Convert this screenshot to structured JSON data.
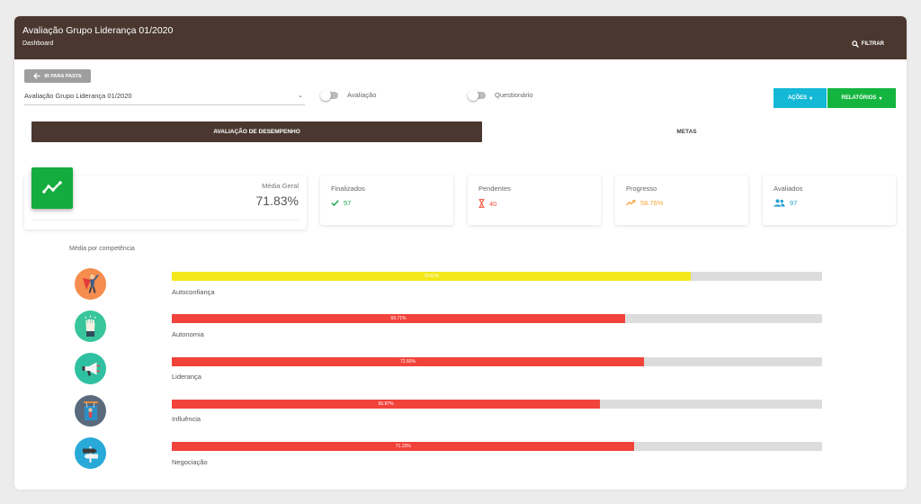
{
  "header": {
    "title": "Avaliação Grupo Liderança 01/2020",
    "subtitle": "Dashboard",
    "filter_label": "FILTRAR"
  },
  "toolbar": {
    "back_label": "IR PARA PASTA",
    "select_value": "Avaliação Grupo Liderança 01/2020",
    "toggle_avaliacao": "Avaliação",
    "toggle_questionario": "Questionário",
    "acoes_label": "AÇÕES",
    "relatorios_label": "RELATÓRIOS"
  },
  "tabs": {
    "active": "AVALIAÇÃO DE DESEMPENHO",
    "other": "METAS"
  },
  "summary": {
    "label": "Média Geral",
    "value": "71.83%"
  },
  "stats": [
    {
      "label": "Finalizados",
      "value": "57",
      "icon": "check-icon",
      "color": "#1ba64a"
    },
    {
      "label": "Pendentes",
      "value": "40",
      "icon": "hourglass-icon",
      "color": "#f0523b"
    },
    {
      "label": "Progresso",
      "value": "58.76%",
      "icon": "trending-up-icon",
      "color": "#f7a23a"
    },
    {
      "label": "Avaliados",
      "value": "97",
      "icon": "people-icon",
      "color": "#25a0d0"
    }
  ],
  "competencies": {
    "title": "Média por competência",
    "items": [
      {
        "name": "Autoconfiança",
        "percent": 79.81,
        "label": "79.81%",
        "color": "#f2e81a",
        "icon": "hero-icon"
      },
      {
        "name": "Autonomia",
        "percent": 69.71,
        "label": "69.71%",
        "color": "#f2433a",
        "icon": "raised-fist-icon"
      },
      {
        "name": "Liderança",
        "percent": 72.6,
        "label": "72.60%",
        "color": "#f2433a",
        "icon": "megaphone-icon"
      },
      {
        "name": "Influência",
        "percent": 65.87,
        "label": "65.87%",
        "color": "#f2433a",
        "icon": "puppet-icon"
      },
      {
        "name": "Negociação",
        "percent": 71.15,
        "label": "71.15%",
        "color": "#f2433a",
        "icon": "signpost-icon"
      }
    ]
  },
  "colors": {
    "header_bg": "#4a3830",
    "accent_cyan": "#12b8d6",
    "accent_green": "#13b53f",
    "bar_track": "#dcdcdc"
  }
}
